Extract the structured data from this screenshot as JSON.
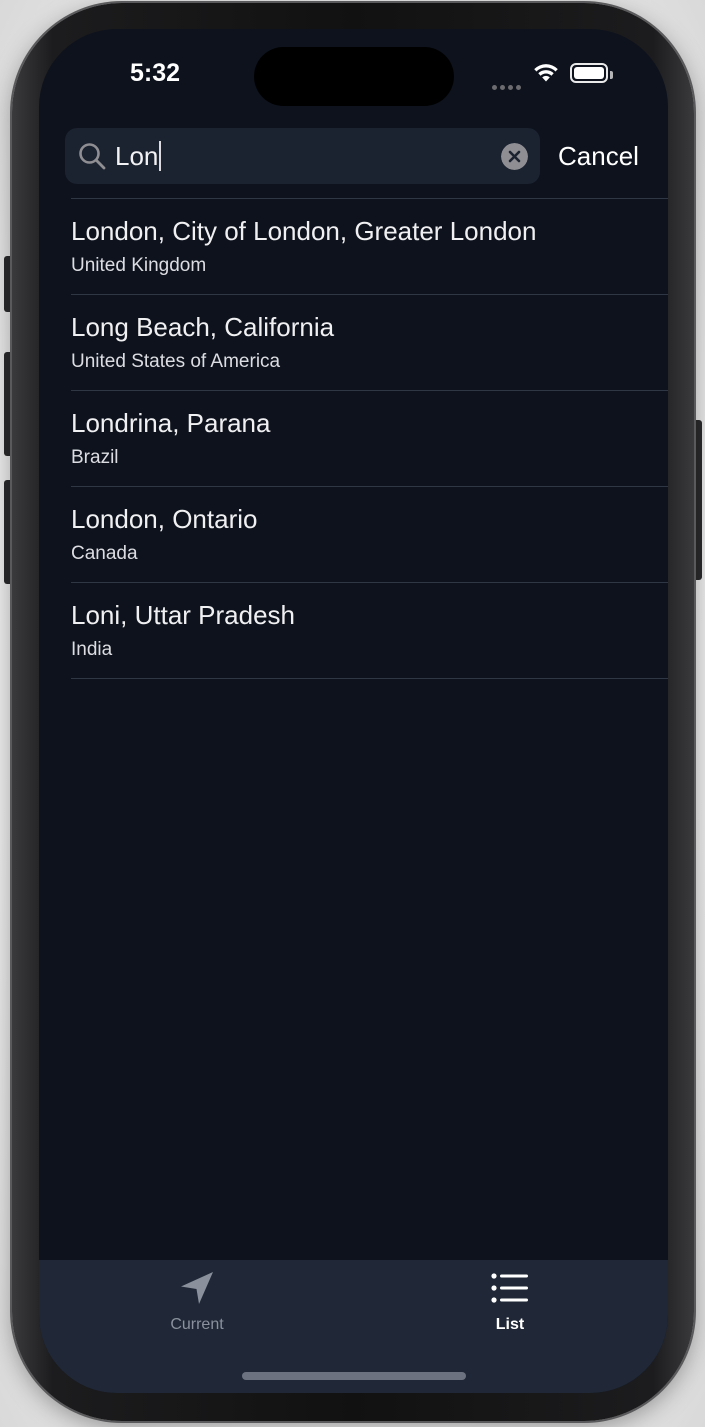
{
  "status_bar": {
    "time": "5:32"
  },
  "search": {
    "query": "Lon",
    "cancel_label": "Cancel"
  },
  "results": [
    {
      "title": "London, City of London, Greater London",
      "subtitle": "United Kingdom"
    },
    {
      "title": "Long Beach, California",
      "subtitle": "United States of America"
    },
    {
      "title": "Londrina, Parana",
      "subtitle": "Brazil"
    },
    {
      "title": "London, Ontario",
      "subtitle": "Canada"
    },
    {
      "title": "Loni, Uttar Pradesh",
      "subtitle": "India"
    }
  ],
  "tab_bar": {
    "tabs": [
      {
        "label": "Current",
        "icon": "location-arrow-icon",
        "selected": false
      },
      {
        "label": "List",
        "icon": "list-icon",
        "selected": true
      }
    ]
  },
  "colors": {
    "background": "#0d121c",
    "search_field": "#1b2230",
    "tab_bar": "#202837",
    "separator": "#2f3644",
    "tab_inactive": "#8a909c",
    "tab_active": "#ffffff"
  }
}
